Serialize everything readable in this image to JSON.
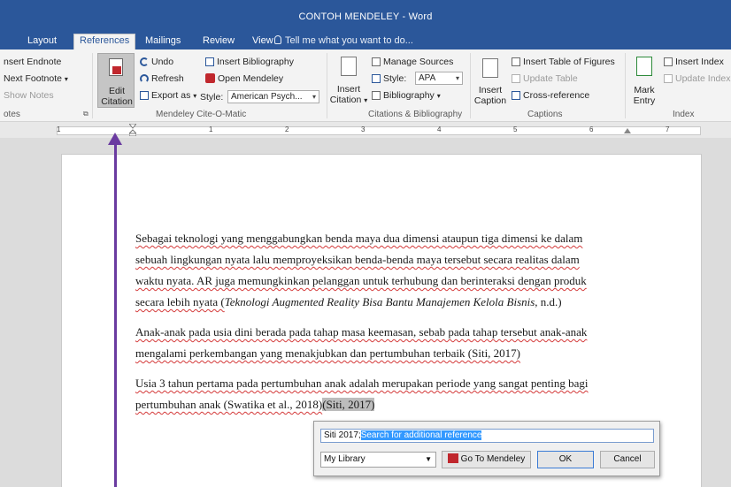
{
  "window": {
    "title": "CONTOH MENDELEY - Word"
  },
  "tabs": [
    {
      "label": "Layout",
      "active": false
    },
    {
      "label": "References",
      "active": true
    },
    {
      "label": "Mailings",
      "active": false
    },
    {
      "label": "Review",
      "active": false
    },
    {
      "label": "View",
      "active": false
    }
  ],
  "tell_me": "Tell me what you want to do...",
  "ribbon": {
    "footnotes": {
      "insert_endnote": "nsert Endnote",
      "next_footnote": "Next Footnote",
      "show_notes": "Show Notes",
      "group_label": "otes"
    },
    "mendeley": {
      "edit_citation_line1": "Edit",
      "edit_citation_line2": "Citation",
      "undo": "Undo",
      "refresh": "Refresh",
      "export_as": "Export as",
      "insert_bibliography": "Insert Bibliography",
      "open_mendeley": "Open Mendeley",
      "style_label": "Style:",
      "style_value": "American Psych...",
      "group_label": "Mendeley Cite-O-Matic"
    },
    "citations": {
      "insert_citation_line1": "Insert",
      "insert_citation_line2": "Citation",
      "manage_sources": "Manage Sources",
      "style_label": "Style:",
      "style_value": "APA",
      "bibliography": "Bibliography",
      "group_label": "Citations & Bibliography"
    },
    "captions": {
      "insert_caption_line1": "Insert",
      "insert_caption_line2": "Caption",
      "insert_table_of_figures": "Insert Table of Figures",
      "update_table": "Update Table",
      "cross_reference": "Cross-reference",
      "group_label": "Captions"
    },
    "index": {
      "mark_entry_line1": "Mark",
      "mark_entry_line2": "Entry",
      "insert_index": "Insert Index",
      "update_index": "Update Index",
      "group_label": "Index"
    }
  },
  "ruler": {
    "numbers": [
      "1",
      "1",
      "2",
      "3",
      "4",
      "5",
      "6",
      "7"
    ]
  },
  "document": {
    "paragraph1": {
      "line1": "Sebagai teknologi yang menggabungkan benda maya dua dimensi ataupun tiga dimensi ke dalam",
      "line2": "sebuah lingkungan nyata lalu memproyeksikan benda-benda maya tersebut secara realitas dalam",
      "line3": "waktu nyata. AR juga memungkinkan pelanggan untuk terhubung dan berinteraksi dengan produk",
      "line4_start": "secara lebih nyata (",
      "line4_italic": "Teknologi Augmented Reality Bisa Bantu Manajemen Kelola Bisnis",
      "line4_end": ", n.d.)"
    },
    "paragraph2": {
      "line1": "Anak-anak pada usia dini berada pada tahap masa keemasan, sebab pada tahap tersebut anak-anak",
      "line2": "mengalami perkembangan yang menakjubkan dan pertumbuhan terbaik (Siti, 2017)"
    },
    "paragraph3": {
      "line1": "Usia 3 tahun pertama pada pertumbuhan anak adalah merupakan periode yang sangat penting bagi",
      "line2_start": "pertumbuhan anak (Swatika et al., 2018)",
      "line2_highlight": "(Siti, 2017)"
    }
  },
  "citation_popup": {
    "search_prefix": "Siti 2017;",
    "search_selected": "Search for additional reference",
    "library": "My Library",
    "go_to_mendeley": "Go To Mendeley",
    "ok": "OK",
    "cancel": "Cancel"
  },
  "colors": {
    "title_bar": "#2b579a",
    "arrow": "#6a3ba0",
    "mendeley_red": "#c0272d"
  }
}
